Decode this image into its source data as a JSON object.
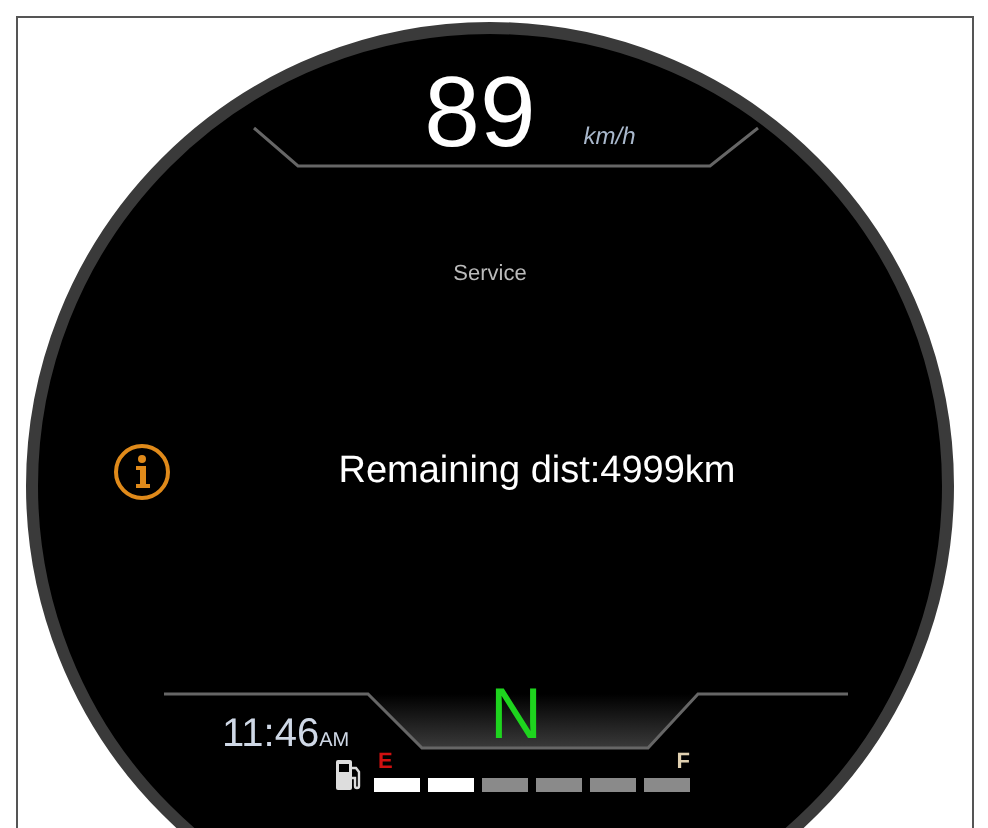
{
  "speed": {
    "value": "89",
    "unit": "km/h"
  },
  "message": {
    "title": "Service",
    "text": "Remaining dist:4999km"
  },
  "gear": "N",
  "clock": {
    "time": "11:46",
    "period": "AM"
  },
  "fuel": {
    "empty_label": "E",
    "full_label": "F",
    "level": 0.333
  }
}
